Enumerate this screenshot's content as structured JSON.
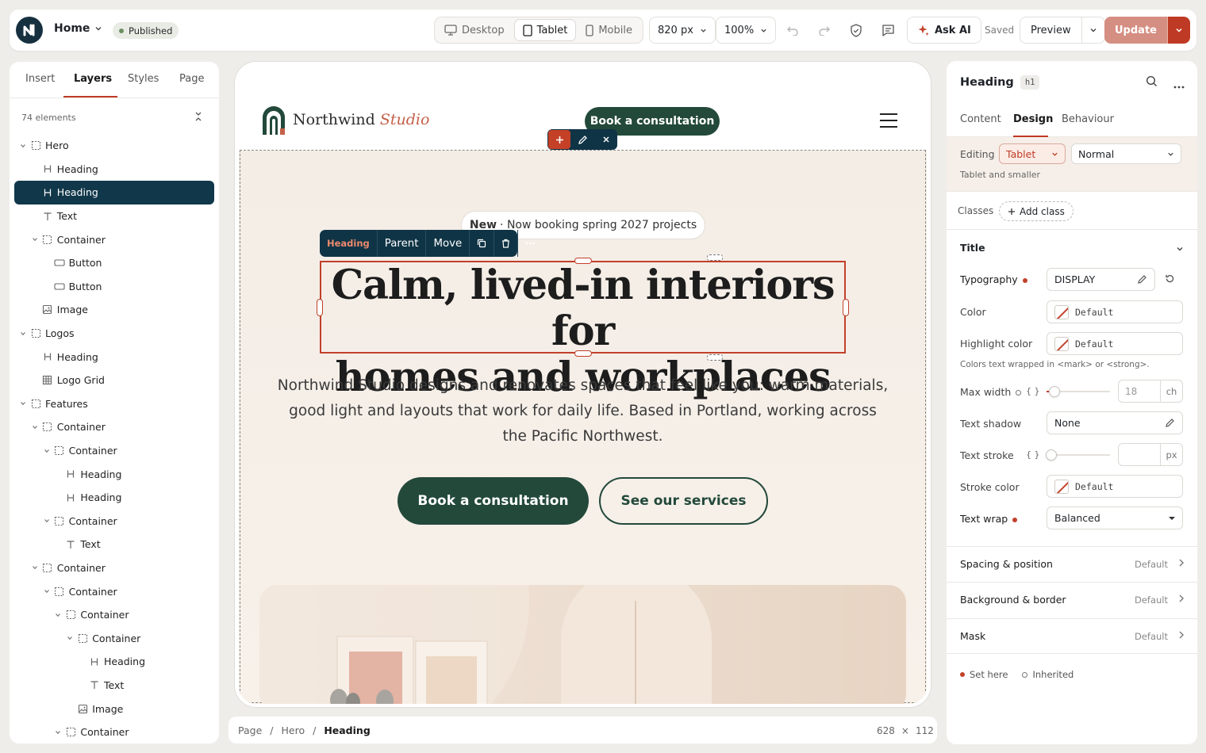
{
  "topbar": {
    "page_name": "Home",
    "status": "Published",
    "devices": [
      {
        "label": "Desktop",
        "icon": "desktop-icon",
        "active": false
      },
      {
        "label": "Tablet",
        "icon": "tablet-icon",
        "active": true
      },
      {
        "label": "Mobile",
        "icon": "mobile-icon",
        "active": false
      }
    ],
    "width_value": "820 px",
    "zoom_value": "100%",
    "ask_ai": "Ask AI",
    "saved": "Saved",
    "preview": "Preview",
    "update": "Update"
  },
  "left_panel": {
    "tabs": [
      "Insert",
      "Layers",
      "Styles",
      "Page"
    ],
    "active_tab": "Layers",
    "element_count": "74 elements",
    "tree": [
      {
        "label": "Hero",
        "depth": 0,
        "icon": "box",
        "caret": true
      },
      {
        "label": "Heading",
        "depth": 1,
        "icon": "heading",
        "caret": false
      },
      {
        "label": "Heading",
        "depth": 1,
        "icon": "heading",
        "caret": false,
        "selected": true
      },
      {
        "label": "Text",
        "depth": 1,
        "icon": "text",
        "caret": false
      },
      {
        "label": "Container",
        "depth": 1,
        "icon": "box",
        "caret": true
      },
      {
        "label": "Button",
        "depth": 2,
        "icon": "button",
        "caret": false
      },
      {
        "label": "Button",
        "depth": 2,
        "icon": "button",
        "caret": false
      },
      {
        "label": "Image",
        "depth": 1,
        "icon": "image",
        "caret": false
      },
      {
        "label": "Logos",
        "depth": 0,
        "icon": "box",
        "caret": true
      },
      {
        "label": "Heading",
        "depth": 1,
        "icon": "heading",
        "caret": false
      },
      {
        "label": "Logo Grid",
        "depth": 1,
        "icon": "grid",
        "caret": false
      },
      {
        "label": "Features",
        "depth": 0,
        "icon": "box",
        "caret": true
      },
      {
        "label": "Container",
        "depth": 1,
        "icon": "box",
        "caret": true
      },
      {
        "label": "Container",
        "depth": 2,
        "icon": "box",
        "caret": true
      },
      {
        "label": "Heading",
        "depth": 3,
        "icon": "heading",
        "caret": false
      },
      {
        "label": "Heading",
        "depth": 3,
        "icon": "heading",
        "caret": false
      },
      {
        "label": "Container",
        "depth": 2,
        "icon": "box",
        "caret": true
      },
      {
        "label": "Text",
        "depth": 3,
        "icon": "text",
        "caret": false
      },
      {
        "label": "Container",
        "depth": 1,
        "icon": "box",
        "caret": true
      },
      {
        "label": "Container",
        "depth": 2,
        "icon": "box",
        "caret": true
      },
      {
        "label": "Container",
        "depth": 3,
        "icon": "box",
        "caret": true
      },
      {
        "label": "Container",
        "depth": 4,
        "icon": "box",
        "caret": true
      },
      {
        "label": "Heading",
        "depth": 5,
        "icon": "heading",
        "caret": false
      },
      {
        "label": "Text",
        "depth": 5,
        "icon": "text",
        "caret": false
      },
      {
        "label": "Image",
        "depth": 4,
        "icon": "image",
        "caret": false
      },
      {
        "label": "Container",
        "depth": 3,
        "icon": "box",
        "caret": true
      }
    ]
  },
  "canvas": {
    "brand_name": "Northwind",
    "brand_accent": "Studio",
    "nav_cta": "Book a consultation",
    "announcement_bold": "New",
    "announcement_text": "· Now booking spring 2027 projects",
    "element_toolbar": {
      "type": "Heading",
      "parent": "Parent",
      "move": "Move"
    },
    "heading_line1": "Calm, lived-in interiors for",
    "heading_line2": "homes and workplaces",
    "subtext": "Northwind Studio designs and renovates spaces that feel like you: warm materials, good light and layouts that work for daily life. Based in Portland, working across the Pacific Northwest.",
    "primary_cta": "Book a consultation",
    "secondary_cta": "See our services"
  },
  "breadcrumb": {
    "items": [
      "Page",
      "Hero",
      "Heading"
    ],
    "dims_w": "628",
    "dims_x": "×",
    "dims_h": "112"
  },
  "right_panel": {
    "element": "Heading",
    "tag": "h1",
    "tabs": [
      "Content",
      "Design",
      "Behaviour"
    ],
    "active_tab": "Design",
    "editing_label": "Editing",
    "editing_device": "Tablet",
    "editing_state": "Normal",
    "editing_note": "Tablet and smaller",
    "classes_label": "Classes",
    "add_class": "Add class",
    "section_title": "Title",
    "typography_label": "Typography",
    "typography_value": "DISPLAY",
    "color_label": "Color",
    "color_value": "Default",
    "highlight_label": "Highlight color",
    "highlight_value": "Default",
    "highlight_note": "Colors text wrapped in <mark> or <strong>.",
    "maxwidth_label": "Max width",
    "maxwidth_value": "18",
    "maxwidth_unit": "ch",
    "maxwidth_level": 0.05,
    "shadow_label": "Text shadow",
    "shadow_value": "None",
    "stroke_label": "Text stroke",
    "stroke_unit": "px",
    "stroke_level": 0,
    "stroke_color_label": "Stroke color",
    "stroke_color_value": "Default",
    "wrap_label": "Text wrap",
    "wrap_value": "Balanced",
    "sections": [
      {
        "name": "Spacing & position",
        "value": "Default"
      },
      {
        "name": "Background & border",
        "value": "Default"
      },
      {
        "name": "Mask",
        "value": "Default"
      }
    ],
    "legend_set": "Set here",
    "legend_inherited": "Inherited"
  },
  "colors": {
    "accent": "#bf3a24",
    "brand_green": "#23493b",
    "navy": "#11374a"
  }
}
